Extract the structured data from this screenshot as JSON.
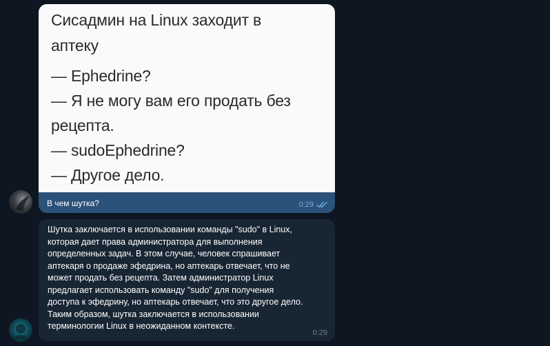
{
  "outgoing": {
    "image_text": [
      "Сисадмин на Linux заходит в",
      "аптеку",
      "— Ephedrine?",
      "— Я не могу вам его продать без",
      "рецепта.",
      "— sudoEphedrine?",
      "— Другое дело."
    ],
    "caption": "В чем шутка?",
    "time": "0:29",
    "status_icon": "double-check-icon"
  },
  "incoming": {
    "lines": [
      "Шутка заключается в использовании команды \"sudo\" в Linux,",
      "которая дает права администратора для выполнения",
      "определенных задач. В этом случае, человек спрашивает",
      "аптекаря о продаже эфедрина, но аптекарь отвечает, что не",
      "может продать без рецепта. Затем администратор Linux",
      "предлагает использовать команду \"sudo\" для получения",
      "доступа к эфедрину, но аптекарь отвечает, что это другое дело.",
      "Таким образом, шутка заключается в использовании",
      "терминологии Linux в неожиданном контексте."
    ],
    "time": "0:29"
  },
  "colors": {
    "background": "#0e1621",
    "outgoing_bubble": "#2b5278",
    "incoming_bubble": "#182533",
    "checkmark": "#6ab3f3"
  }
}
